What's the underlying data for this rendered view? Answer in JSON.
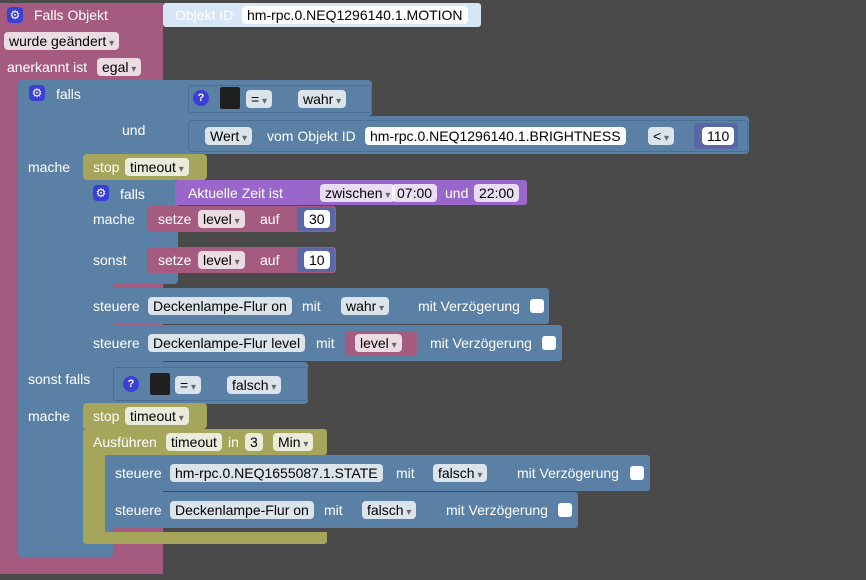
{
  "colors": {
    "event": "#a55b80",
    "logic": "#5b80a5",
    "timer": "#a5a55b",
    "variable": "#a55b80",
    "time": "#9966cc",
    "object": "#d7e6f5",
    "number": "#5b67a5",
    "background": "#4a4a4a"
  },
  "icons": {
    "gear": "gear-icon",
    "help": "help-icon"
  },
  "trigger": {
    "title": "Falls Objekt",
    "object_label": "Objekt ID",
    "object_id": "hm-rpc.0.NEQ1296140.1.MOTION",
    "change_mode": "wurde geändert",
    "ack_label": "anerkannt ist",
    "ack_value": "egal"
  },
  "if_block": {
    "falls_label": "falls",
    "compare_op": "=",
    "compare_value": "wahr",
    "and_label": "und",
    "wert_label": "Wert",
    "from_object_label": "vom Objekt ID",
    "brightness_id": "hm-rpc.0.NEQ1296140.1.BRIGHTNESS",
    "lt_op": "<",
    "threshold": "110",
    "mache_label": "mache",
    "stop_label": "stop",
    "timer_name": "timeout",
    "inner_falls_label": "falls",
    "time_label": "Aktuelle Zeit ist",
    "time_mode": "zwischen",
    "time_from": "07:00",
    "und_label": "und",
    "time_to": "22:00",
    "inner_mache_label": "mache",
    "setze_label": "setze",
    "var_name": "level",
    "auf_label": "auf",
    "level_day": "30",
    "sonst_label": "sonst",
    "level_night": "10",
    "steuere_label": "steuere",
    "on_target": "Deckenlampe-Flur on",
    "mit_label": "mit",
    "on_value": "wahr",
    "delay_label": "mit Verzögerung",
    "level_target": "Deckenlampe-Flur level",
    "level_var": "level"
  },
  "else_if": {
    "sonst_falls_label": "sonst falls",
    "compare_op": "=",
    "compare_value": "falsch",
    "mache_label": "mache",
    "stop_label": "stop",
    "timer_name": "timeout",
    "ausfuehren_label": "Ausführen",
    "in_label": "in",
    "delay_amount": "3",
    "delay_unit": "Min",
    "steuere_label": "steuere",
    "target1": "hm-rpc.0.NEQ1655087.1.STATE",
    "mit_label": "mit",
    "value1": "falsch",
    "delay_label": "mit Verzögerung",
    "target2": "Deckenlampe-Flur on",
    "value2": "falsch"
  }
}
